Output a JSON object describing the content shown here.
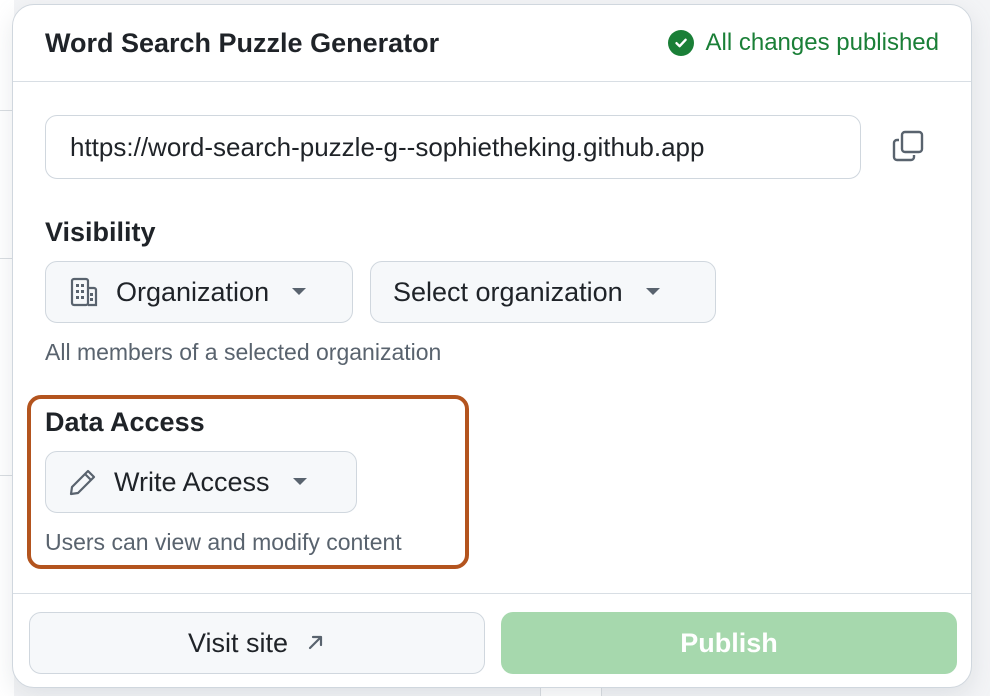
{
  "header": {
    "title": "Word Search Puzzle Generator",
    "status": "All changes published",
    "status_color": "#1a7f37"
  },
  "url": {
    "value": "https://word-search-puzzle-g--sophietheking.github.app"
  },
  "visibility": {
    "label": "Visibility",
    "selected": "Organization",
    "org_select": "Select organization",
    "hint": "All members of a selected organization"
  },
  "data_access": {
    "label": "Data Access",
    "selected": "Write Access",
    "hint": "Users can view and modify content",
    "highlight_color": "#b3541e"
  },
  "footer": {
    "visit_label": "Visit site",
    "publish_label": "Publish",
    "publish_color": "#a6d8ad"
  },
  "icons": {
    "status": "check-circle-icon",
    "copy": "copy-icon",
    "visibility": "organization-icon",
    "access": "pencil-icon",
    "caret": "triangle-down-icon",
    "external": "arrow-up-right-icon"
  }
}
